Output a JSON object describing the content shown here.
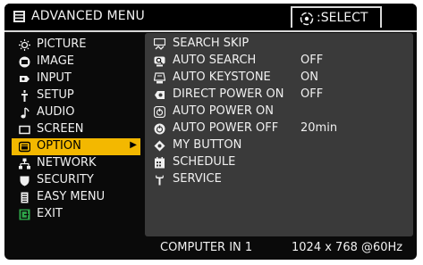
{
  "header": {
    "title": "ADVANCED MENU",
    "select_label": ":SELECT"
  },
  "menu": {
    "items": [
      {
        "label": "PICTURE",
        "icon": "picture-icon"
      },
      {
        "label": "IMAGE",
        "icon": "image-icon"
      },
      {
        "label": "INPUT",
        "icon": "input-icon"
      },
      {
        "label": "SETUP",
        "icon": "setup-icon"
      },
      {
        "label": "AUDIO",
        "icon": "audio-icon"
      },
      {
        "label": "SCREEN",
        "icon": "screen-icon"
      },
      {
        "label": "OPTION",
        "icon": "option-icon",
        "selected": true
      },
      {
        "label": "NETWORK",
        "icon": "network-icon"
      },
      {
        "label": "SECURITY",
        "icon": "security-icon"
      },
      {
        "label": "EASY MENU",
        "icon": "easy-menu-icon"
      },
      {
        "label": "EXIT",
        "icon": "exit-icon"
      }
    ]
  },
  "submenu": {
    "items": [
      {
        "label": "SEARCH SKIP",
        "value": "",
        "icon": "search-skip-icon"
      },
      {
        "label": "AUTO SEARCH",
        "value": "OFF",
        "icon": "auto-search-icon"
      },
      {
        "label": "AUTO KEYSTONE",
        "value": "ON",
        "icon": "auto-keystone-icon"
      },
      {
        "label": "DIRECT POWER ON",
        "value": "OFF",
        "icon": "direct-power-on-icon"
      },
      {
        "label": "AUTO POWER ON",
        "value": "",
        "icon": "auto-power-on-icon"
      },
      {
        "label": "AUTO POWER OFF",
        "value": "20min",
        "icon": "auto-power-off-icon"
      },
      {
        "label": "MY BUTTON",
        "value": "",
        "icon": "my-button-icon"
      },
      {
        "label": "SCHEDULE",
        "value": "",
        "icon": "schedule-icon"
      },
      {
        "label": "SERVICE",
        "value": "",
        "icon": "service-icon"
      }
    ]
  },
  "status": {
    "source": "COMPUTER IN 1",
    "resolution": "1024 x 768 @60Hz"
  },
  "colors": {
    "highlight": "#f3b800",
    "panel": "#3a3a3a",
    "background": "#0a0a0a",
    "text": "#f0f0f0"
  }
}
